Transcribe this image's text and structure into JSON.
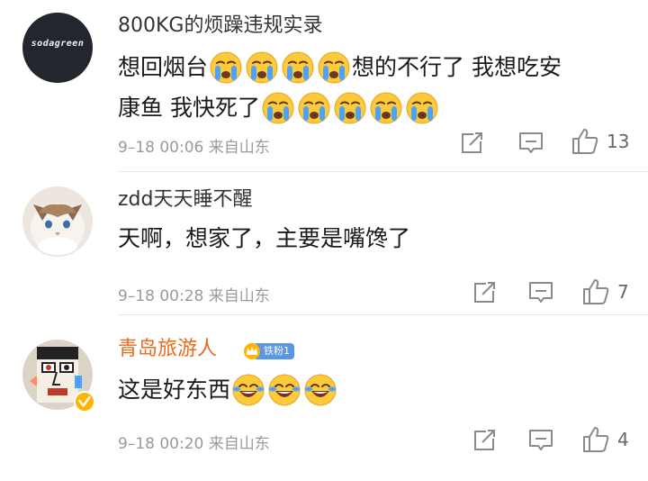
{
  "comments": [
    {
      "avatar_text": "sodagreen",
      "username": "800KG的烦躁违规实录",
      "text_line1_a": "想回烟台",
      "text_line1_b": "想的不行了 我想吃安",
      "text_line2": "康鱼 我快死了",
      "emoji_line1": "crying-emoji",
      "emoji_line1_count": 4,
      "emoji_line2_count": 5,
      "date": "9–18 00:06",
      "source": "来自山东",
      "like_count": "13"
    },
    {
      "username": "zdd天天睡不醒",
      "text": "天啊，想家了，主要是嘴馋了",
      "date": "9–18 00:28",
      "source": "来自山东",
      "like_count": "7"
    },
    {
      "username": "青岛旅游人",
      "fan_badge": "铁粉1",
      "text": "这是好东西",
      "emoji": "laughing-tears-emoji",
      "emoji_count": 3,
      "date": "9–18 00:20",
      "source": "来自山东",
      "like_count": "4",
      "verified": "verified-badge"
    }
  ],
  "colors": {
    "vip_username": "#ea6a1c",
    "meta_gray": "#9a9a9a",
    "fan_badge_bg": "#5b95e6",
    "emoji_yellow": "#ffc93c",
    "tear_blue": "#4aa3ff"
  },
  "icons": {
    "share": "share-icon",
    "comment": "comment-icon",
    "like": "thumbs-up-icon"
  }
}
